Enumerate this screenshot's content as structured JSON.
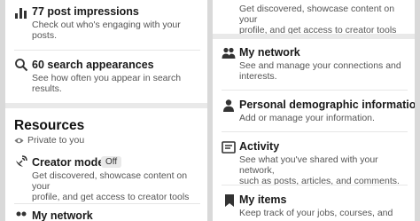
{
  "left": {
    "impressions": {
      "icon": "bar-chart-icon",
      "title": "77 post impressions",
      "desc_line1": "Check out who's engaging with your",
      "desc_line2": "posts."
    },
    "search": {
      "icon": "search-icon",
      "title": "60 search appearances",
      "desc_line1": "See how often you appear in search",
      "desc_line2": "results."
    },
    "resources": {
      "heading": "Resources",
      "private": "Private to you"
    },
    "creator": {
      "icon": "satellite-dish-icon",
      "title": "Creator mode",
      "badge": "Off",
      "desc_line1": "Get discovered, showcase content on your",
      "desc_line2": "profile, and get access to creator tools"
    },
    "network_partial": {
      "title": "My network"
    }
  },
  "right": {
    "creator_partial": {
      "desc_line1": "Get discovered, showcase content on your",
      "desc_line2": "profile, and get access to creator tools"
    },
    "network": {
      "icon": "people-icon",
      "title": "My network",
      "desc_line1": "See and manage your connections and",
      "desc_line2": "interests."
    },
    "demographic": {
      "icon": "person-icon",
      "title": "Personal demographic information",
      "desc_line1": "Add or manage your information."
    },
    "activity": {
      "icon": "activity-card-icon",
      "title": "Activity",
      "desc_line1": "See what you've shared with your network,",
      "desc_line2": "such as posts, articles, and comments."
    },
    "items": {
      "icon": "bookmark-icon",
      "title": "My items",
      "desc_line1": "Keep track of your jobs, courses, and"
    }
  }
}
